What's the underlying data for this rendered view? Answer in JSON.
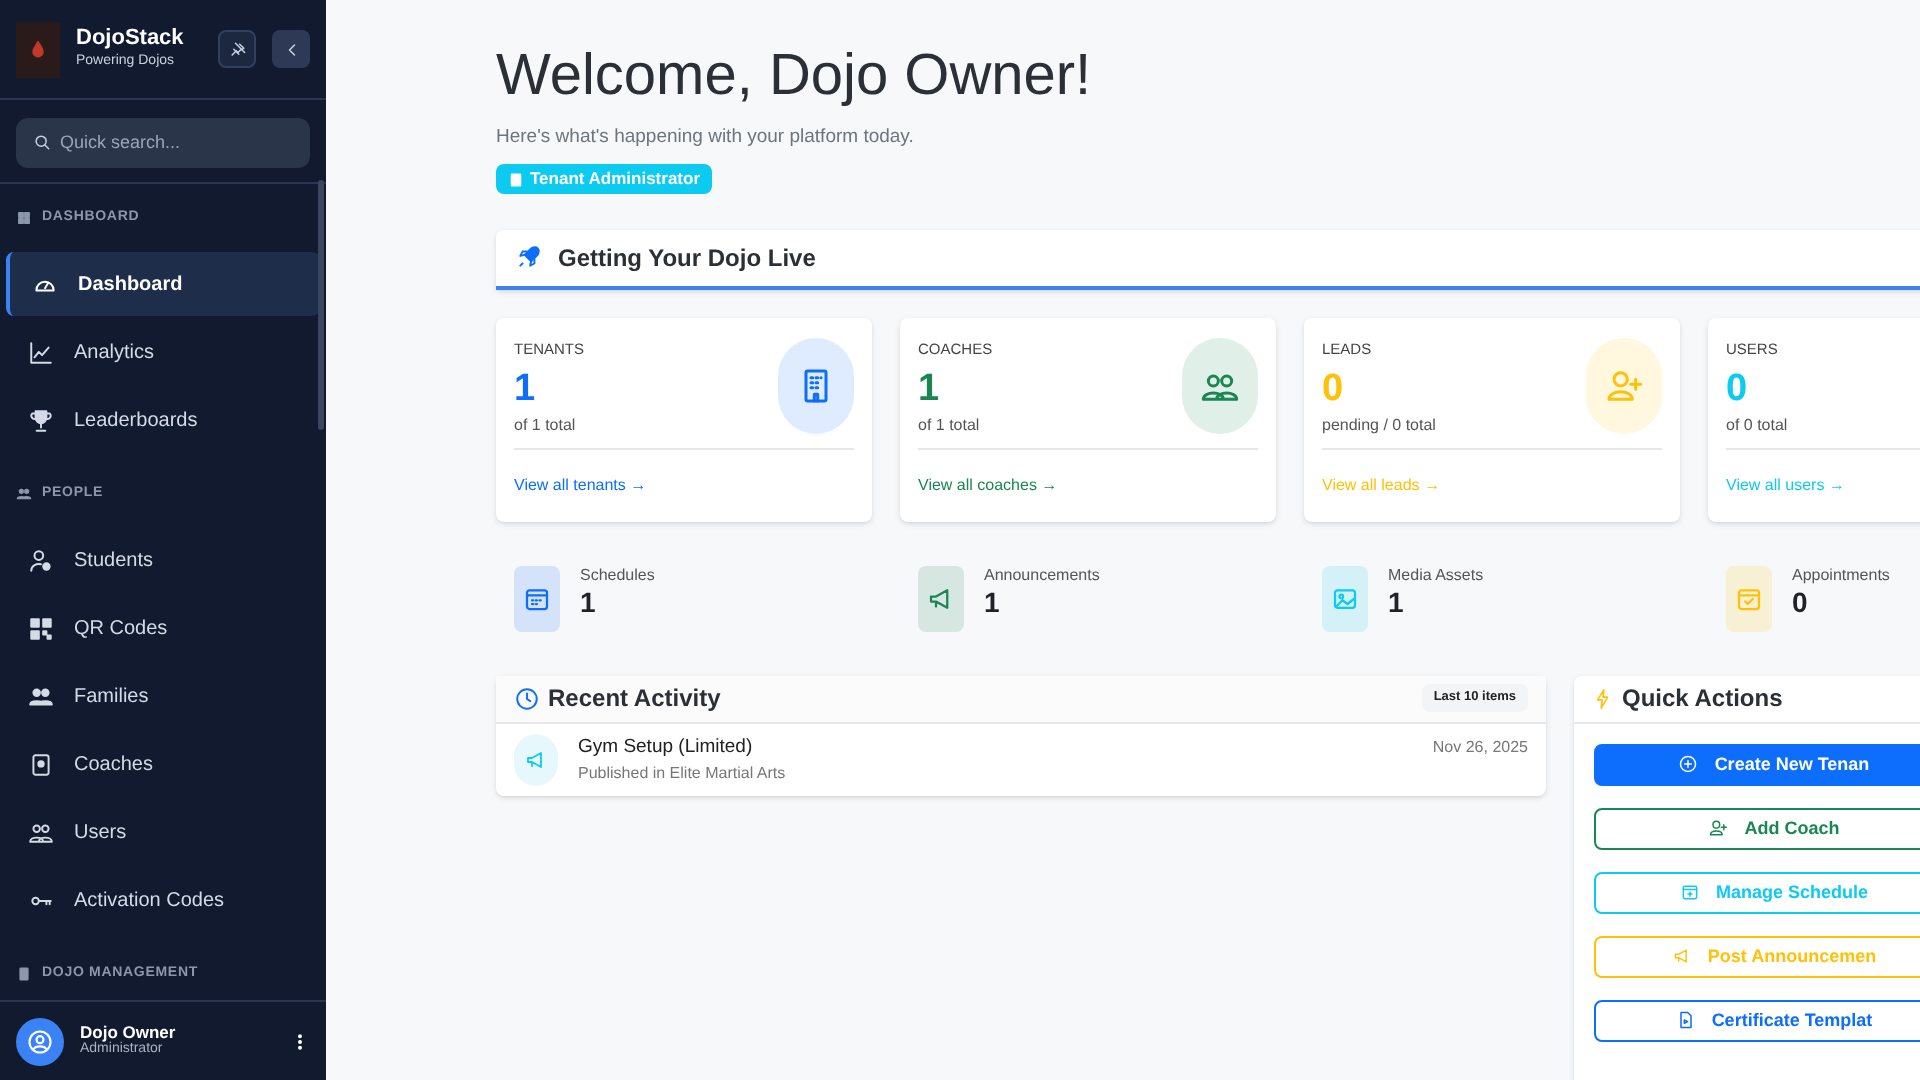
{
  "sidebar": {
    "brand": {
      "title": "DojoStack",
      "subtitle": "Powering Dojos"
    },
    "search": {
      "placeholder": "Quick search..."
    },
    "sections": [
      {
        "title": "DASHBOARD",
        "items": [
          {
            "label": "Dashboard",
            "selected": true
          },
          {
            "label": "Analytics",
            "selected": false
          },
          {
            "label": "Leaderboards",
            "selected": false
          }
        ]
      },
      {
        "title": "PEOPLE",
        "items": [
          {
            "label": "Students",
            "selected": false
          },
          {
            "label": "QR Codes",
            "selected": false
          },
          {
            "label": "Families",
            "selected": false
          },
          {
            "label": "Coaches",
            "selected": false
          },
          {
            "label": "Users",
            "selected": false
          },
          {
            "label": "Activation Codes",
            "selected": false
          }
        ]
      },
      {
        "title": "DOJO MANAGEMENT"
      }
    ],
    "user": {
      "name": "Dojo Owner",
      "role": "Administrator"
    }
  },
  "header": {
    "title": "Welcome, Dojo Owner!",
    "subtitle": "Here's what's happening with your platform today.",
    "badge": "Tenant Administrator"
  },
  "getting_live": {
    "title": "Getting Your Dojo Live"
  },
  "stat_cards": [
    {
      "label": "TENANTS",
      "value": "1",
      "detail": "of 1 total",
      "link": "View all tenants →",
      "color": "#0d6efd"
    },
    {
      "label": "COACHES",
      "value": "1",
      "detail": "of 1 total",
      "link": "View all coaches →",
      "color": "#198754"
    },
    {
      "label": "LEADS",
      "value": "0",
      "detail": "pending / 0 total",
      "link": "View all leads →",
      "color": "#ffc107"
    },
    {
      "label": "USERS",
      "value": "0",
      "detail": "of 0 total",
      "link": "View all users →",
      "color": "#0dcaf0"
    }
  ],
  "mini_stats": [
    {
      "label": "Schedules",
      "value": "1",
      "color": "#0d6efd"
    },
    {
      "label": "Announcements",
      "value": "1",
      "color": "#198754"
    },
    {
      "label": "Media Assets",
      "value": "1",
      "color": "#0dcaf0"
    },
    {
      "label": "Appointments",
      "value": "0",
      "color": "#ffc107"
    }
  ],
  "recent_activity": {
    "title": "Recent Activity",
    "badge": "Last 10 items",
    "items": [
      {
        "title": "Gym Setup (Limited)",
        "subtitle": "Published in Elite Martial Arts",
        "date": "Nov 26, 2025"
      }
    ]
  },
  "quick_actions": {
    "title": "Quick Actions",
    "buttons": [
      {
        "label": "Create New Tenan",
        "kind": "filled",
        "color": "#0d6efd"
      },
      {
        "label": "Add Coach",
        "kind": "outline",
        "color": "#198754"
      },
      {
        "label": "Manage Schedule",
        "kind": "outline",
        "color": "#0dcaf0"
      },
      {
        "label": "Post Announcemen",
        "kind": "outline",
        "color": "#ffc107"
      },
      {
        "label": "Certificate Templat",
        "kind": "outline",
        "color": "#0d6efd"
      }
    ]
  }
}
